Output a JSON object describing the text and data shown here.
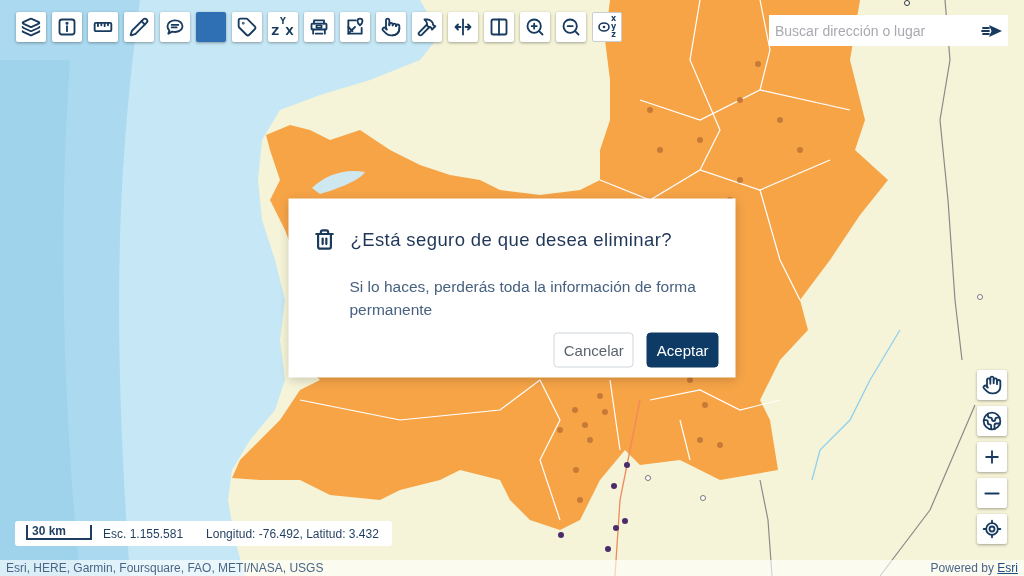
{
  "toolbar": [
    {
      "kind": "tool"
    },
    {
      "kind": "tool"
    },
    {
      "kind": "tool"
    },
    {
      "kind": "tool"
    },
    {
      "kind": "tool"
    },
    {
      "kind": "swatch",
      "color": "#2f70b4"
    },
    {
      "kind": "tool"
    },
    {
      "kind": "letters_triangle",
      "letters": [
        "Y",
        "Z",
        "X"
      ]
    },
    {
      "kind": "tool"
    },
    {
      "kind": "tool"
    },
    {
      "kind": "tool"
    },
    {
      "kind": "tool"
    },
    {
      "kind": "tool"
    },
    {
      "kind": "tool"
    },
    {
      "kind": "tool"
    },
    {
      "kind": "tool"
    },
    {
      "kind": "letters_column",
      "letters": [
        "x",
        "y",
        "z"
      ]
    }
  ],
  "search": {
    "placeholder": "Buscar dirección o lugar"
  },
  "dialog": {
    "title": "¿Está seguro de que desea eliminar?",
    "message": "Si lo haces, perderás toda la información de forma permanente",
    "buttons": [
      {
        "label": "Cancelar",
        "kind": "secondary"
      },
      {
        "label": "Aceptar",
        "kind": "primary"
      }
    ]
  },
  "status_bar": {
    "scale": "30 km",
    "scale_ratio": "Esc. 1.155.581",
    "coordinates": "Longitud: -76.492, Latitud: 3.432"
  },
  "attribution": {
    "sources": "Esri, HERE, Garmin, Foursquare, FAO, METI/NASA, USGS",
    "powered_by": "Powered by",
    "link": "Esri"
  }
}
